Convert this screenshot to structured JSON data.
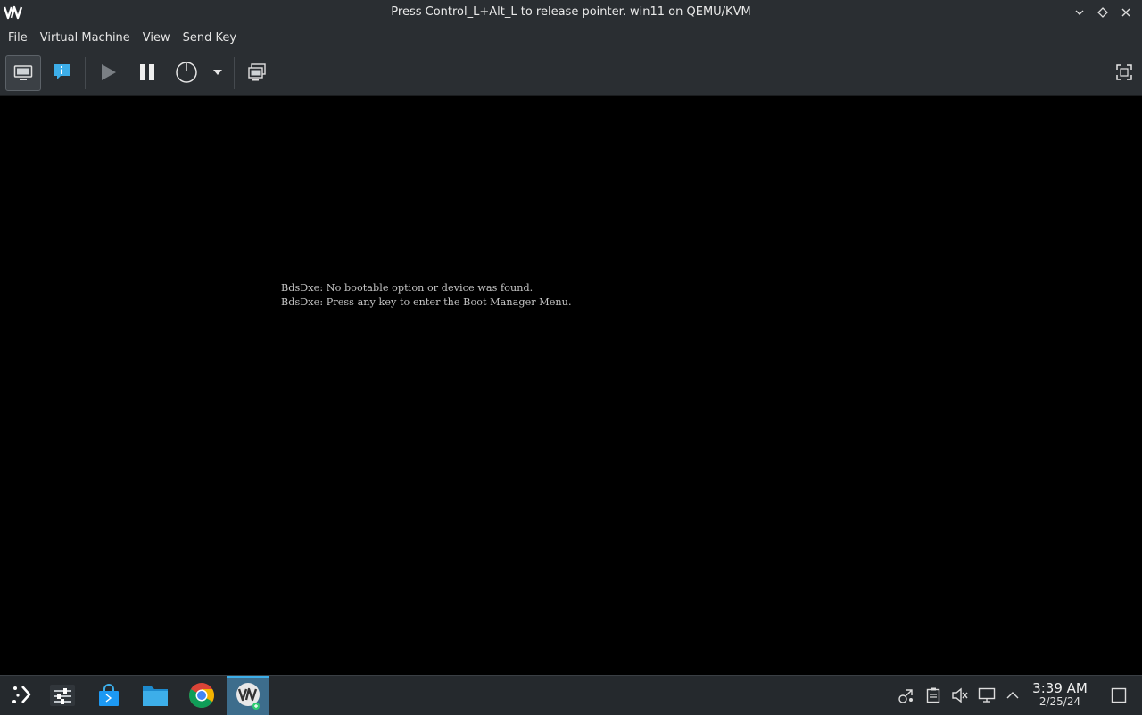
{
  "window": {
    "title": "Press Control_L+Alt_L to release pointer. win11 on QEMU/KVM",
    "logo_text": "VM"
  },
  "menubar": {
    "items": [
      "File",
      "Virtual Machine",
      "View",
      "Send Key"
    ]
  },
  "toolbar": {
    "buttons": [
      "console-view",
      "details-view",
      "run",
      "pause",
      "shutdown",
      "shutdown-menu",
      "snapshots",
      "fullscreen"
    ]
  },
  "vm_console": {
    "lines": [
      "BdsDxe: No bootable option or device was found.",
      "BdsDxe: Press any key to enter the Boot Manager Menu."
    ]
  },
  "taskbar": {
    "apps": [
      "application-launcher",
      "system-settings",
      "discover-store",
      "file-manager",
      "chrome",
      "virt-manager"
    ],
    "tray": [
      "network-share",
      "clipboard",
      "volume-muted",
      "display",
      "show-hidden"
    ],
    "clock": {
      "time": "3:39 AM",
      "date": "2/25/24"
    }
  },
  "colors": {
    "chrome_bg": "#2a2e32",
    "taskbar_bg": "#25292d",
    "accent": "#3daee9",
    "console_text": "#c4c4c4"
  }
}
